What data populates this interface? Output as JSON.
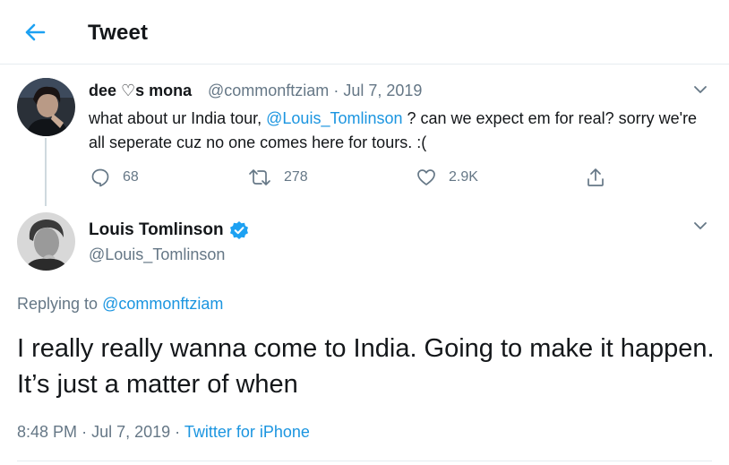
{
  "header": {
    "title": "Tweet",
    "back_icon": "arrow-left-icon"
  },
  "colors": {
    "accent": "#1da1f2",
    "link": "#1b95e0",
    "muted": "#657786",
    "text": "#14171a"
  },
  "reply_tweet": {
    "display_name": "dee ♡s mona",
    "handle": "@commonftziam",
    "separator": "·",
    "date": "Jul 7, 2019",
    "text_before": "what about ur India tour, ",
    "mention": "@Louis_Tomlinson",
    "text_after": " ? can we expect em for real? sorry we're all seperate cuz no one comes here for tours. :(",
    "actions": {
      "replies": "68",
      "retweets": "278",
      "likes": "2.9K"
    }
  },
  "main_tweet": {
    "display_name": "Louis Tomlinson",
    "handle": "@Louis_Tomlinson",
    "replying_prefix": "Replying to",
    "replying_handle": "@commonftziam",
    "text": "I really really wanna come to India. Going to make it happen. It’s just a matter of when",
    "time": "8:48 PM",
    "separator": "·",
    "date": "Jul 7, 2019",
    "source": "Twitter for iPhone"
  }
}
